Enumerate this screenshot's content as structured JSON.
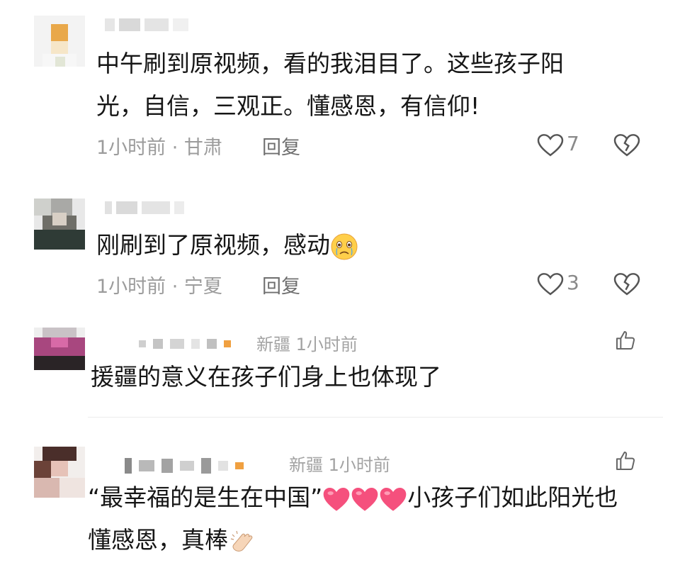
{
  "comments": [
    {
      "text_line1": "中午刷到原视频，看的我泪目了。这些孩子阳",
      "text_line2": "光，自信，三观正。懂感恩，有信仰!",
      "meta": "1小时前 · 甘肃",
      "reply": "回复",
      "likes": "7"
    },
    {
      "text_line1": "刚刷到了原视频，感动",
      "meta": "1小时前 · 宁夏",
      "reply": "回复",
      "likes": "3"
    },
    {
      "text_line1": "援疆的意义在孩子们身上也体现了",
      "meta": "新疆 1小时前"
    },
    {
      "text_line1_a": "“最幸福的是生在中国”",
      "text_line1_b": "小孩子们如此阳光也",
      "text_line2": "懂感恩，真棒",
      "meta": "新疆 1小时前"
    }
  ],
  "icons": {
    "heart": "heart-outline-icon",
    "dislike": "broken-heart-icon",
    "thumb": "thumbs-up-icon",
    "crying": "crying-face-emoji",
    "pink_heart": "pink-heart-emoji",
    "clap": "clapping-hands-emoji"
  },
  "colors": {
    "text": "#161616",
    "meta": "#9c9c9c",
    "heart_pink": "#f0507a"
  }
}
